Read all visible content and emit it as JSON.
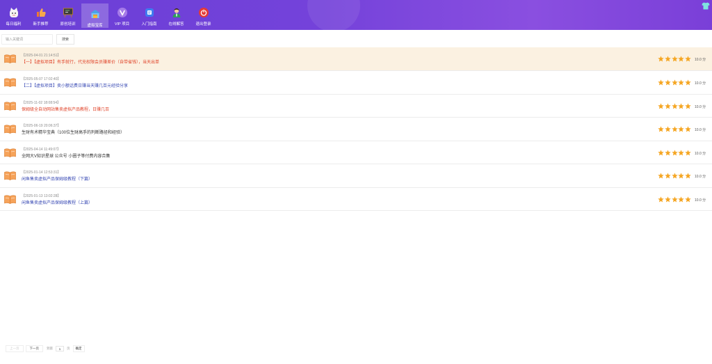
{
  "nav": {
    "items": [
      {
        "label": "每日福利",
        "icon": "cat-gift-icon"
      },
      {
        "label": "新手推荐",
        "icon": "thumbs-up-icon"
      },
      {
        "label": "原创培训",
        "icon": "blackboard-icon"
      },
      {
        "label": "虚拟宝库",
        "icon": "treasure-house-icon",
        "active": true
      },
      {
        "label": "VIP 项目",
        "icon": "vip-icon"
      },
      {
        "label": "入门指南",
        "icon": "guide-book-icon"
      },
      {
        "label": "在线解答",
        "icon": "support-person-icon"
      },
      {
        "label": "退出登录",
        "icon": "logout-icon"
      }
    ]
  },
  "search": {
    "placeholder": "输入关键词",
    "button_label": "搜索"
  },
  "list": {
    "rows": [
      {
        "date": "【2025-04-01 21:14:51】",
        "title": "【一】【虚拟项目】有手就行，代充权限会员赚差价（自带省钱），当天出单",
        "title_color": "#e0442a",
        "stars": 5,
        "score": "10.0 分"
      },
      {
        "date": "【2025-05-07 17:02:40】",
        "title": "【二】【虚拟项目】卖小额话费日赚当天赚几百元经验分享",
        "title_color": "#3a4bb5",
        "stars": 5,
        "score": "10.0 分"
      },
      {
        "date": "【2025-11-02 18:08:54】",
        "title": "保姆级全自动网站售卖虚拟产品教程，日赚几百",
        "title_color": "#e0442a",
        "stars": 5,
        "score": "10.0 分"
      },
      {
        "date": "【2025-06-19 20:06:37】",
        "title": "生财有术精华宝典（100位生财高手的判断路径和经验）",
        "title_color": "#333333",
        "stars": 5,
        "score": "10.0 分"
      },
      {
        "date": "【2025-04-14 11:49:07】",
        "title": "全网大V知识星球 公众号 小圈子等付费内容合集",
        "title_color": "#333333",
        "stars": 5,
        "score": "10.0 分"
      },
      {
        "date": "【2025-01-14 12:53:31】",
        "title": "闲鱼售卖虚拟产品保姆级教程（下篇）",
        "title_color": "#3a4bb5",
        "stars": 5,
        "score": "10.0 分"
      },
      {
        "date": "【2025-01-13 13:02:28】",
        "title": "闲鱼售卖虚拟产品保姆级教程（上篇）",
        "title_color": "#3a4bb5",
        "stars": 5,
        "score": "10.0 分"
      }
    ]
  },
  "pager": {
    "prev": "上一页",
    "next": "下一页",
    "goto": "到第",
    "page_value": "1",
    "page_unit": "页",
    "confirm": "确定"
  },
  "colors": {
    "nav_bg_start": "#6a3fd6",
    "nav_bg_end": "#8a4fe0",
    "highlight_row": "#fbf1e1",
    "star": "#f5a623"
  }
}
